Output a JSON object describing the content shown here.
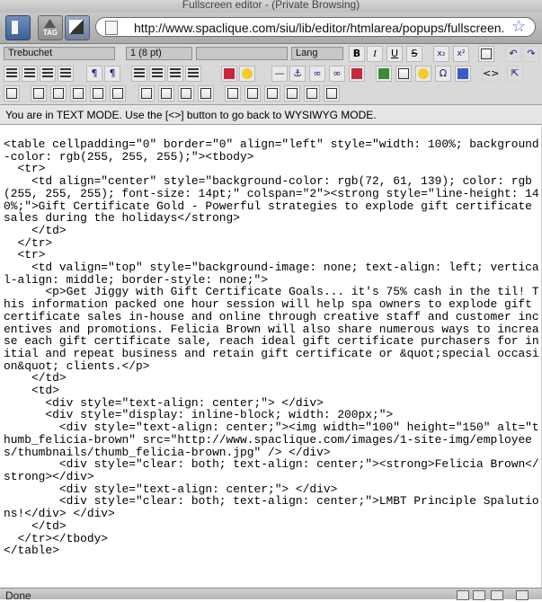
{
  "window": {
    "title": "Fullscreen editor - (Private Browsing)"
  },
  "nav": {
    "url": "http://www.spaclique.com/siu/lib/editor/htmlarea/popups/fullscreen.html",
    "tag_label": "TAG"
  },
  "toolbar": {
    "font_family": "Trebuchet",
    "font_size": "1 (8 pt)",
    "block_format": "",
    "language": "Lang",
    "bold": "B",
    "italic": "I",
    "underline": "U",
    "strike": "S",
    "subscript": "x₂",
    "superscript": "x²",
    "html_toggle": "<>"
  },
  "status_message": "You are in TEXT MODE. Use the [<>] button to go back to WYSIWYG MODE.",
  "editor": {
    "source": "<table cellpadding=\"0\" border=\"0\" align=\"left\" style=\"width: 100%; background-color: rgb(255, 255, 255);\"><tbody>\n  <tr>\n    <td align=\"center\" style=\"background-color: rgb(72, 61, 139); color: rgb(255, 255, 255); font-size: 14pt;\" colspan=\"2\"><strong style=\"line-height: 140%;\">Gift Certificate Gold - Powerful strategies to explode gift certificate sales during the holidays</strong>\n    </td>\n  </tr>\n  <tr>\n    <td valign=\"top\" style=\"background-image: none; text-align: left; vertical-align: middle; border-style: none;\">\n      <p>Get Jiggy with Gift Certificate Goals... it's 75% cash in the til! This information packed one hour session will help spa owners to explode gift certificate sales in-house and online through creative staff and customer incentives and promotions. Felicia Brown will also share numerous ways to increase each gift certificate sale, reach ideal gift certificate purchasers for initial and repeat business and retain gift certificate or &quot;special occasion&quot; clients.</p>\n    </td>\n    <td>\n      <div style=\"text-align: center;\"> </div>\n      <div style=\"display: inline-block; width: 200px;\">\n        <div style=\"text-align: center;\"><img width=\"100\" height=\"150\" alt=\"thumb_felicia-brown\" src=\"http://www.spaclique.com/images/1-site-img/employees/thumbnails/thumb_felicia-brown.jpg\" /> </div>\n        <div style=\"clear: both; text-align: center;\"><strong>Felicia Brown</strong></div>\n        <div style=\"text-align: center;\"> </div>\n        <div style=\"clear: both; text-align: center;\">LMBT Principle Spalutions!</div> </div>\n    </td>\n  </tr></tbody>\n</table>"
  },
  "statusbar": {
    "text": "Done"
  }
}
